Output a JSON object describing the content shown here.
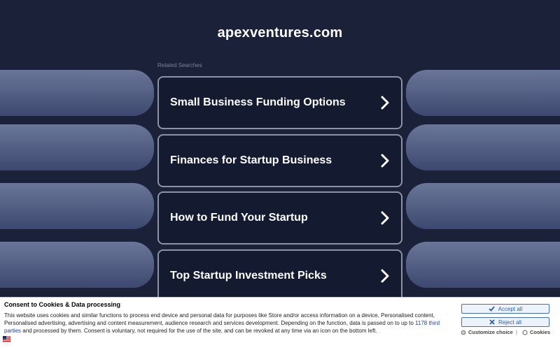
{
  "site": {
    "title": "apexventures.com"
  },
  "related": {
    "heading": "Related Searches",
    "items": [
      {
        "label": "Small Business Funding Options"
      },
      {
        "label": "Finances for Startup Business"
      },
      {
        "label": "How to Fund Your Startup"
      },
      {
        "label": "Top Startup Investment Picks"
      }
    ]
  },
  "consent": {
    "title": "Consent to Cookies & Data processing",
    "body_pre": "This website uses cookies and similar functions to process end device and personal data for purposes like Store and/or access information on a device, Personalised content, Personalised advertising, advertising and content measurement, audience research and services development. Depending on the function, data is passed on to up to ",
    "third_parties_link": "1178 third parties",
    "body_post": " and processed by them. Consent is voluntary, not required for the use of the site, and can be revoked at any time via an icon on the bottom left.",
    "accept_label": "Accept all",
    "reject_label": "Reject all",
    "customize_label": "Customize choice",
    "separator": "|",
    "cookies_label": "Cookies"
  },
  "colors": {
    "background": "#1b2138",
    "card_border": "#8b93a8",
    "accent": "#2b5fb4"
  }
}
